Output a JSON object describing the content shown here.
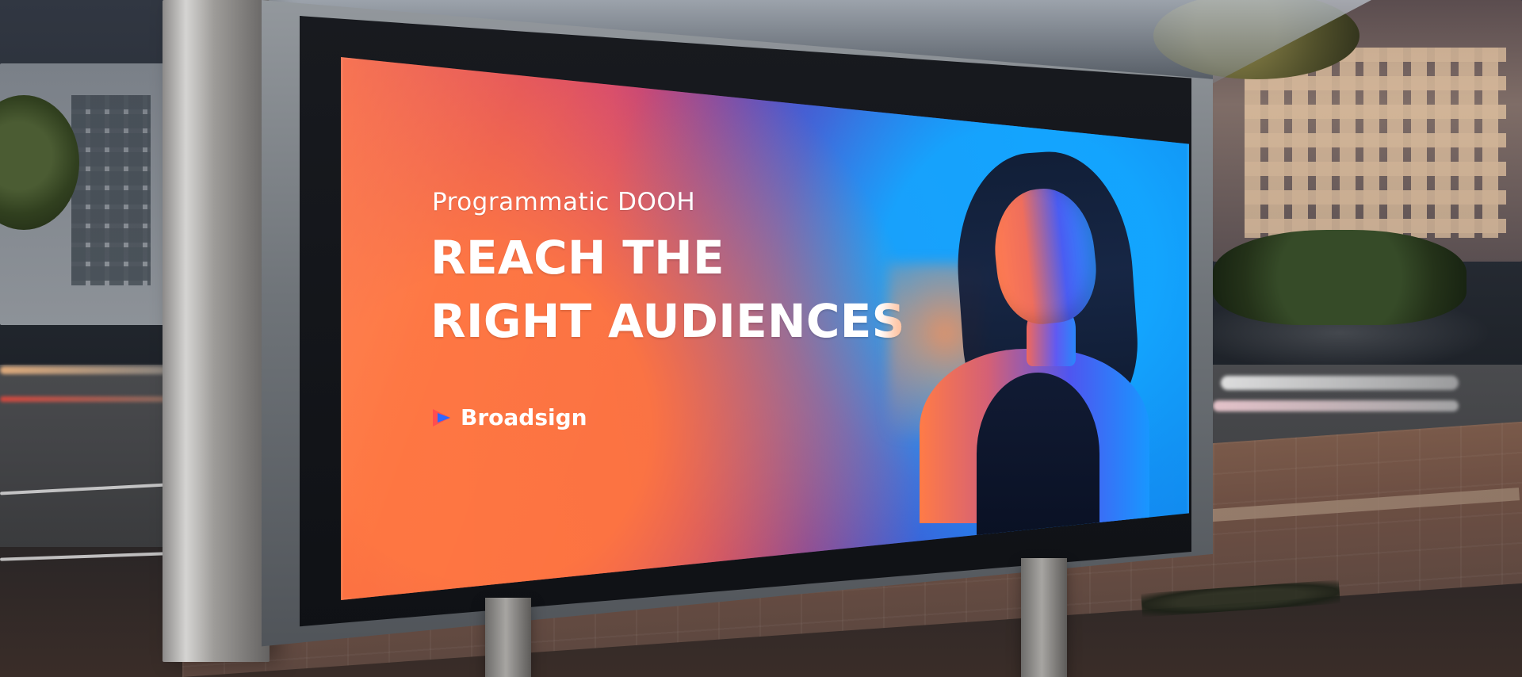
{
  "ad": {
    "subheading": "Programmatic DOOH",
    "heading_line_1": "REACH THE",
    "heading_line_2": "RIGHT AUDIENCES",
    "brand_name": "Broadsign"
  },
  "icons": {
    "brand_icon": "play-triangle-icon"
  },
  "colors": {
    "panel_orange": "#f45d3b",
    "panel_magenta": "#ce3f76",
    "panel_purple": "#5f27b0",
    "panel_blue": "#1d70ea",
    "text_white": "#ffffff",
    "brand_icon_red": "#ff4b4b",
    "brand_icon_blue": "#2a66ff"
  }
}
